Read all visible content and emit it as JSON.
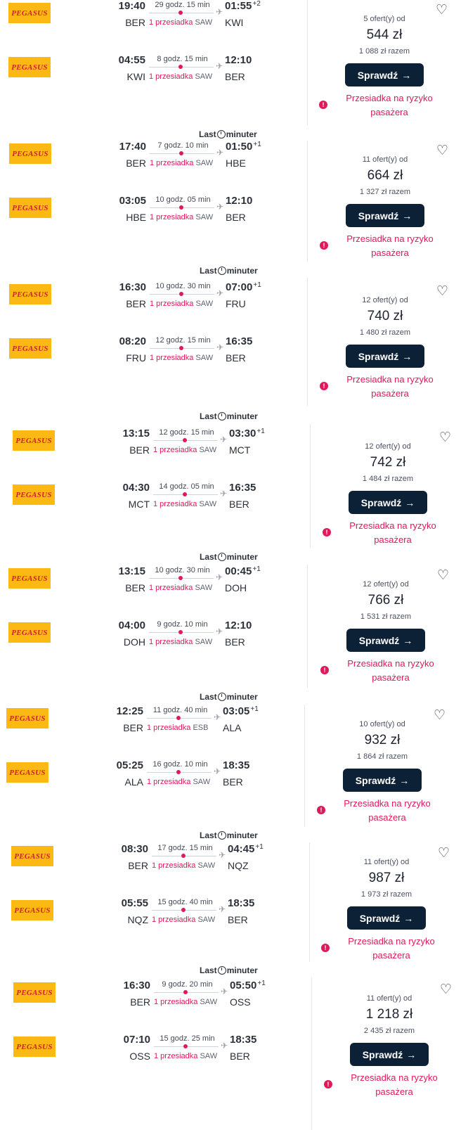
{
  "labels": {
    "offers_suffix": "ofert(y) od",
    "total_suffix": "razem",
    "check_button": "Sprawdź",
    "stops_label": "1 przesiadka",
    "risk_warning": "Przesiadka na ryzyko pasażera",
    "partner": "Lastminuter",
    "airline": "PEGASUS"
  },
  "colors": {
    "accent": "#e0195a",
    "button": "#0d2136",
    "airline_bg": "#fdb913",
    "airline_text": "#d1202f"
  },
  "icons": {
    "favorite": "heart-outline-icon",
    "arrow": "arrow-right-icon",
    "plane": "plane-icon",
    "warning": "exclamation-circle-icon",
    "partner": "clock-icon"
  },
  "results": [
    {
      "offers": "5 ofert(y) od",
      "price": "544 zł",
      "total": "1 088 zł razem",
      "outbound": {
        "dep_time": "19:40",
        "dep": "BER",
        "arr_time": "01:55",
        "plus": "+2",
        "arr": "KWI",
        "duration": "29 godz. 15 min",
        "stops": "1 przesiadka",
        "via": "SAW"
      },
      "inbound": {
        "dep_time": "04:55",
        "dep": "KWI",
        "arr_time": "12:10",
        "plus": "",
        "arr": "BER",
        "duration": "8 godz. 15 min",
        "stops": "1 przesiadka",
        "via": "SAW"
      }
    },
    {
      "offers": "11 ofert(y) od",
      "price": "664 zł",
      "total": "1 327 zł razem",
      "outbound": {
        "dep_time": "17:40",
        "dep": "BER",
        "arr_time": "01:50",
        "plus": "+1",
        "arr": "HBE",
        "duration": "7 godz. 10 min",
        "stops": "1 przesiadka",
        "via": "SAW"
      },
      "inbound": {
        "dep_time": "03:05",
        "dep": "HBE",
        "arr_time": "12:10",
        "plus": "",
        "arr": "BER",
        "duration": "10 godz. 05 min",
        "stops": "1 przesiadka",
        "via": "SAW"
      }
    },
    {
      "offers": "12 ofert(y) od",
      "price": "740 zł",
      "total": "1 480 zł razem",
      "outbound": {
        "dep_time": "16:30",
        "dep": "BER",
        "arr_time": "07:00",
        "plus": "+1",
        "arr": "FRU",
        "duration": "10 godz. 30 min",
        "stops": "1 przesiadka",
        "via": "SAW"
      },
      "inbound": {
        "dep_time": "08:20",
        "dep": "FRU",
        "arr_time": "16:35",
        "plus": "",
        "arr": "BER",
        "duration": "12 godz. 15 min",
        "stops": "1 przesiadka",
        "via": "SAW"
      }
    },
    {
      "offers": "12 ofert(y) od",
      "price": "742 zł",
      "total": "1 484 zł razem",
      "outbound": {
        "dep_time": "13:15",
        "dep": "BER",
        "arr_time": "03:30",
        "plus": "+1",
        "arr": "MCT",
        "duration": "12 godz. 15 min",
        "stops": "1 przesiadka",
        "via": "SAW"
      },
      "inbound": {
        "dep_time": "04:30",
        "dep": "MCT",
        "arr_time": "16:35",
        "plus": "",
        "arr": "BER",
        "duration": "14 godz. 05 min",
        "stops": "1 przesiadka",
        "via": "SAW"
      }
    },
    {
      "offers": "12 ofert(y) od",
      "price": "766 zł",
      "total": "1 531 zł razem",
      "outbound": {
        "dep_time": "13:15",
        "dep": "BER",
        "arr_time": "00:45",
        "plus": "+1",
        "arr": "DOH",
        "duration": "10 godz. 30 min",
        "stops": "1 przesiadka",
        "via": "SAW"
      },
      "inbound": {
        "dep_time": "04:00",
        "dep": "DOH",
        "arr_time": "12:10",
        "plus": "",
        "arr": "BER",
        "duration": "9 godz. 10 min",
        "stops": "1 przesiadka",
        "via": "SAW"
      }
    },
    {
      "offers": "10 ofert(y) od",
      "price": "932 zł",
      "total": "1 864 zł razem",
      "outbound": {
        "dep_time": "12:25",
        "dep": "BER",
        "arr_time": "03:05",
        "plus": "+1",
        "arr": "ALA",
        "duration": "11 godz. 40 min",
        "stops": "1 przesiadka",
        "via": "ESB"
      },
      "inbound": {
        "dep_time": "05:25",
        "dep": "ALA",
        "arr_time": "18:35",
        "plus": "",
        "arr": "BER",
        "duration": "16 godz. 10 min",
        "stops": "1 przesiadka",
        "via": "SAW"
      }
    },
    {
      "offers": "11 ofert(y) od",
      "price": "987 zł",
      "total": "1 973 zł razem",
      "outbound": {
        "dep_time": "08:30",
        "dep": "BER",
        "arr_time": "04:45",
        "plus": "+1",
        "arr": "NQZ",
        "duration": "17 godz. 15 min",
        "stops": "1 przesiadka",
        "via": "SAW"
      },
      "inbound": {
        "dep_time": "05:55",
        "dep": "NQZ",
        "arr_time": "18:35",
        "plus": "",
        "arr": "BER",
        "duration": "15 godz. 40 min",
        "stops": "1 przesiadka",
        "via": "SAW"
      }
    },
    {
      "offers": "11 ofert(y) od",
      "price": "1 218 zł",
      "total": "2 435 zł razem",
      "outbound": {
        "dep_time": "16:30",
        "dep": "BER",
        "arr_time": "05:50",
        "plus": "+1",
        "arr": "OSS",
        "duration": "9 godz. 20 min",
        "stops": "1 przesiadka",
        "via": "SAW"
      },
      "inbound": {
        "dep_time": "07:10",
        "dep": "OSS",
        "arr_time": "18:35",
        "plus": "",
        "arr": "BER",
        "duration": "15 godz. 25 min",
        "stops": "1 przesiadka",
        "via": "SAW"
      }
    }
  ]
}
